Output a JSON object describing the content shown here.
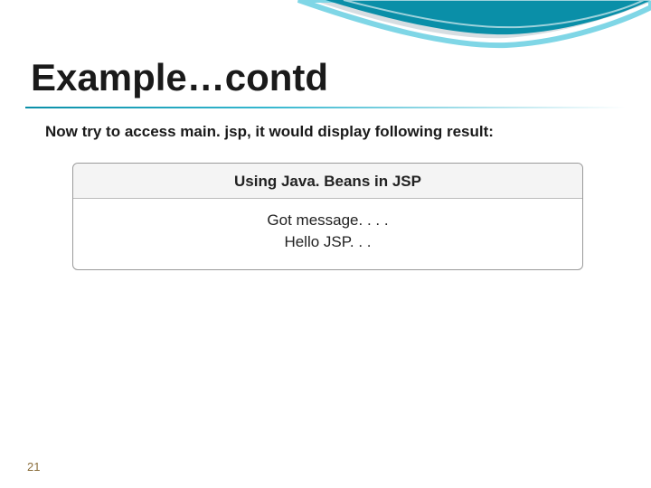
{
  "slide": {
    "title": "Example…contd",
    "subtext": "Now try to access main. jsp, it would display following result:",
    "result": {
      "header": "Using Java. Beans in JSP",
      "line1": "Got message. . . .",
      "line2": "Hello JSP. . ."
    },
    "page_number": "21",
    "colors": {
      "wave_dark": "#0a8fa8",
      "wave_light": "#7fd6e6",
      "wave_gray": "#dfe6ea"
    }
  }
}
